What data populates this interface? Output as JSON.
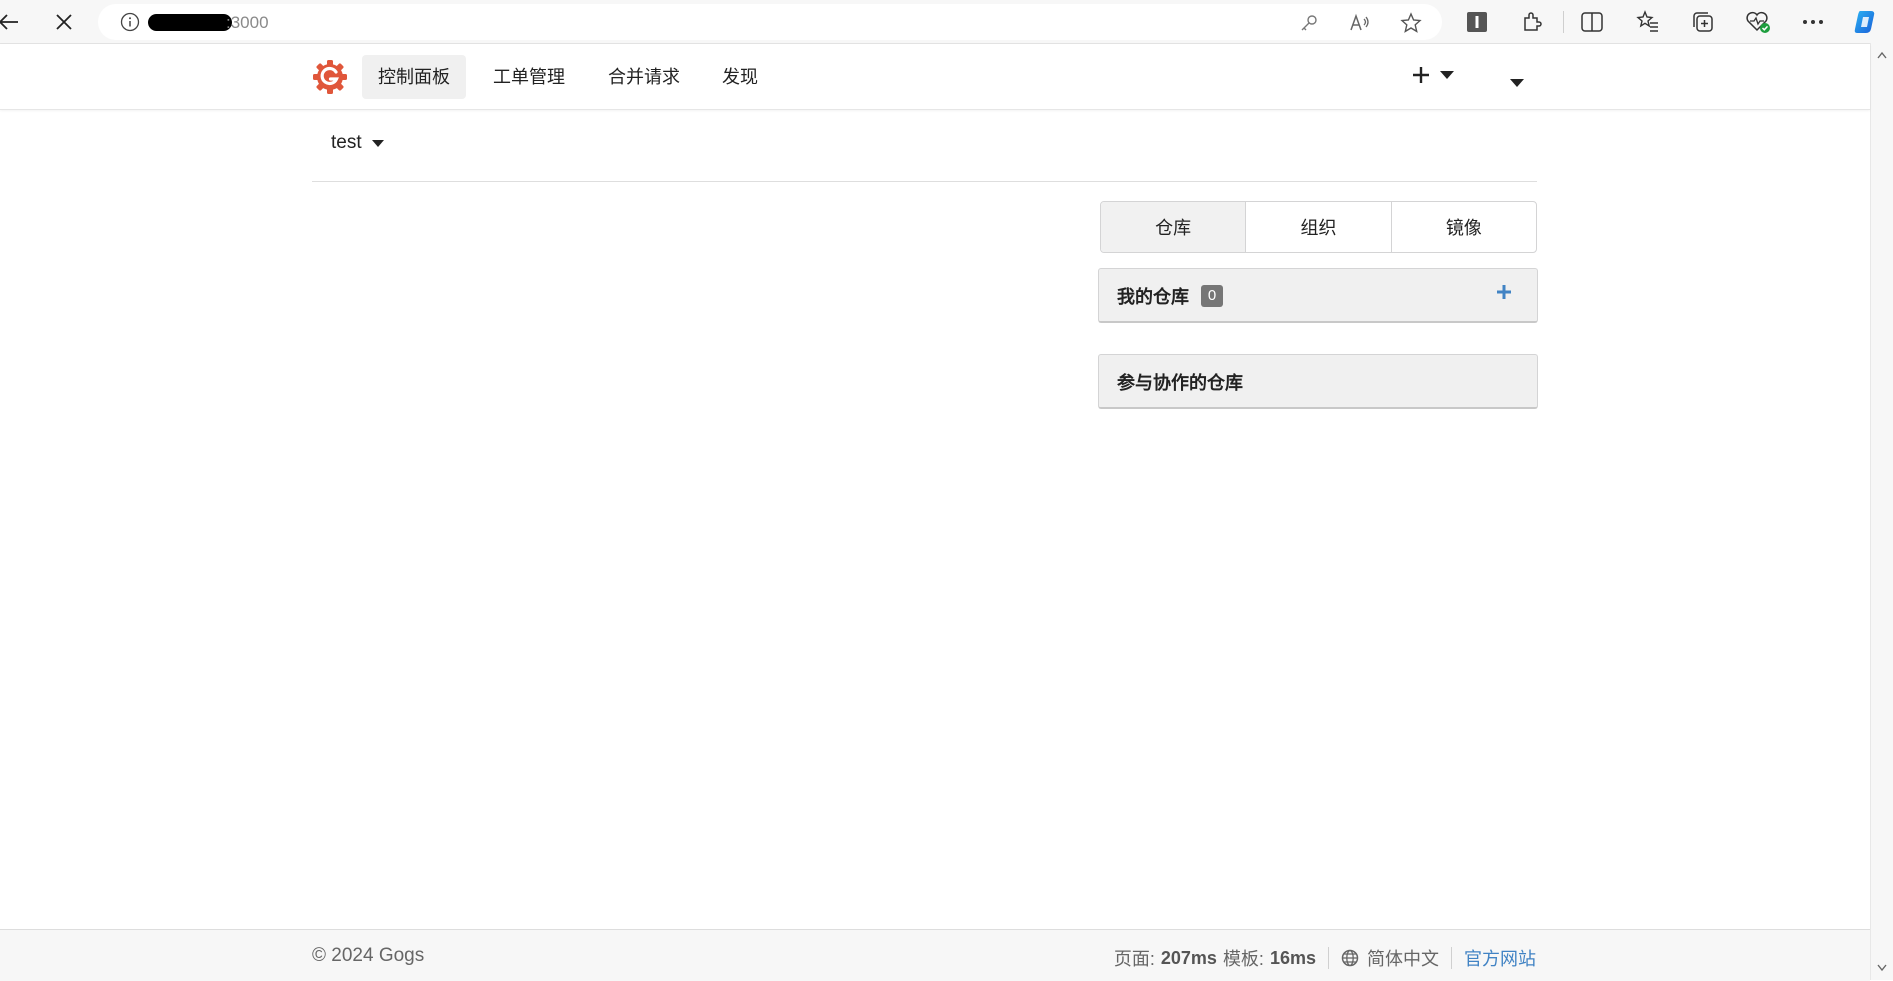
{
  "browser": {
    "url_visible": ":3000"
  },
  "header": {
    "nav": [
      {
        "label": "控制面板",
        "active": true
      },
      {
        "label": "工单管理",
        "active": false
      },
      {
        "label": "合并请求",
        "active": false
      },
      {
        "label": "发现",
        "active": false
      }
    ]
  },
  "context": {
    "user": "test"
  },
  "dashboard": {
    "tabs": [
      {
        "label": "仓库",
        "active": true
      },
      {
        "label": "组织",
        "active": false
      },
      {
        "label": "镜像",
        "active": false
      }
    ],
    "my_repos": {
      "title": "我的仓库",
      "count": "0"
    },
    "collab_repos": {
      "title": "参与协作的仓库"
    }
  },
  "footer": {
    "copyright": "© 2024 Gogs",
    "page_label": "页面:",
    "page_time": "207ms",
    "template_label": "模板:",
    "template_time": "16ms",
    "language": "简体中文",
    "official_site": "官方网站"
  },
  "colors": {
    "logo": "#e0563a",
    "link": "#4183c4",
    "add": "#4183c4"
  }
}
